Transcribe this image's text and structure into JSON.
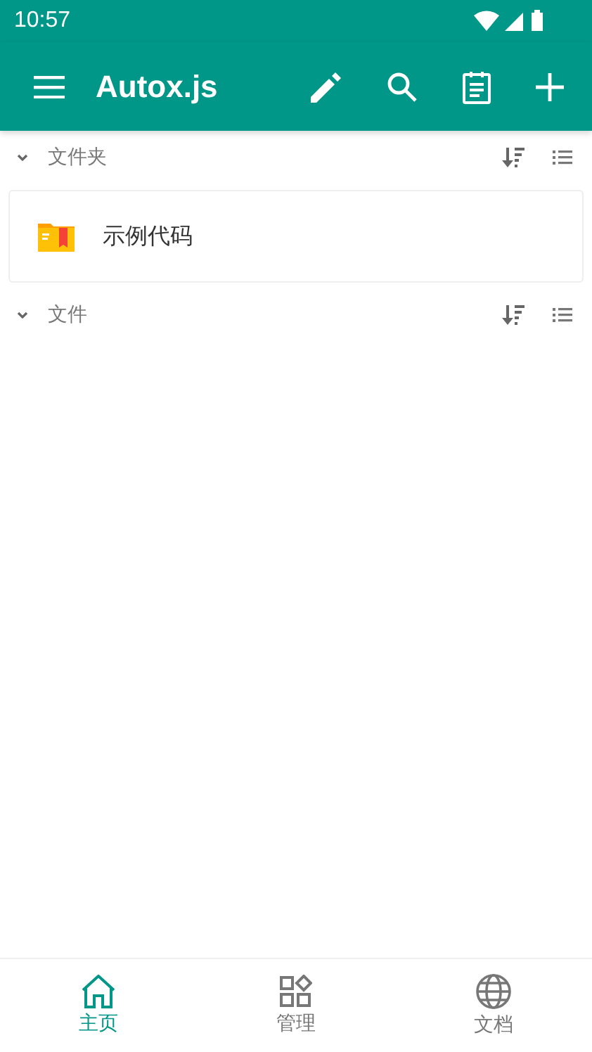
{
  "status_bar": {
    "time": "10:57"
  },
  "app_bar": {
    "title": "Autox.js"
  },
  "sections": [
    {
      "title": "文件夹",
      "expanded": true,
      "items": [
        {
          "name": "示例代码"
        }
      ]
    },
    {
      "title": "文件",
      "expanded": true
    }
  ],
  "bottom_nav": [
    {
      "label": "主页",
      "selected": true
    },
    {
      "label": "管理",
      "selected": false
    },
    {
      "label": "文档",
      "selected": false
    }
  ]
}
